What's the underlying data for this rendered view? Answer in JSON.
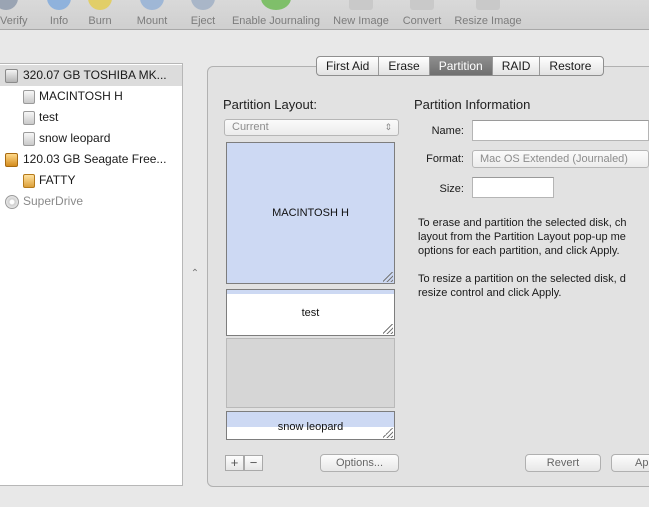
{
  "toolbar": {
    "items": [
      {
        "label": "Verify",
        "icon": "verify-icon",
        "color": "#9aa4b3"
      },
      {
        "label": "Info",
        "icon": "info-icon",
        "color": "#8fb2dc"
      },
      {
        "label": "Burn",
        "icon": "burn-icon",
        "color": "#e1ce68"
      },
      {
        "label": "Mount",
        "icon": "mount-icon",
        "color": "#9fb7d6"
      },
      {
        "label": "Eject",
        "icon": "eject-icon",
        "color": "#a9b6c8"
      },
      {
        "label": "Enable Journaling",
        "icon": "journaling-icon",
        "color": "#7fbf6a"
      },
      {
        "label": "New Image",
        "icon": "new-image-icon",
        "color": "#c9c9c9"
      },
      {
        "label": "Convert",
        "icon": "convert-icon",
        "color": "#c9c9c9"
      },
      {
        "label": "Resize Image",
        "icon": "resize-image-icon",
        "color": "#c9c9c9"
      }
    ]
  },
  "sidebar": {
    "items": [
      {
        "label": "320.07 GB TOSHIBA MK...",
        "icon": "internal-disk-icon",
        "selected": true
      },
      {
        "label": "MACINTOSH H",
        "icon": "volume-icon"
      },
      {
        "label": "test",
        "icon": "volume-icon"
      },
      {
        "label": "snow leopard",
        "icon": "volume-icon"
      },
      {
        "label": "120.03 GB Seagate Free...",
        "icon": "external-disk-icon"
      },
      {
        "label": "FATTY",
        "icon": "external-volume-icon"
      },
      {
        "label": "SuperDrive",
        "icon": "optical-drive-icon",
        "dimmed": true
      }
    ]
  },
  "tabs": [
    {
      "label": "First Aid"
    },
    {
      "label": "Erase"
    },
    {
      "label": "Partition",
      "active": true
    },
    {
      "label": "RAID"
    },
    {
      "label": "Restore"
    }
  ],
  "layout_section": {
    "heading": "Partition Layout:",
    "popup_value": "Current",
    "partitions": [
      "MACINTOSH H",
      "test",
      "snow leopard"
    ],
    "add_label": "+",
    "remove_label": "−",
    "options_label": "Options..."
  },
  "info_section": {
    "heading": "Partition Information",
    "name_label": "Name:",
    "format_label": "Format:",
    "format_value": "Mac OS Extended (Journaled)",
    "size_label": "Size:",
    "erase_text": [
      "To erase and partition the selected disk, ch",
      "layout from the Partition Layout pop-up me",
      "options for each partition, and click Apply."
    ],
    "resize_text": [
      "To resize a partition on the selected disk, d",
      "resize control and click Apply."
    ]
  },
  "buttons": {
    "revert_label": "Revert",
    "apply_label": "Ap"
  },
  "colors": {
    "partition_fill": "#cdd9f3",
    "selection": "#dcdcdc",
    "active_tab": "#7a7a7a"
  }
}
